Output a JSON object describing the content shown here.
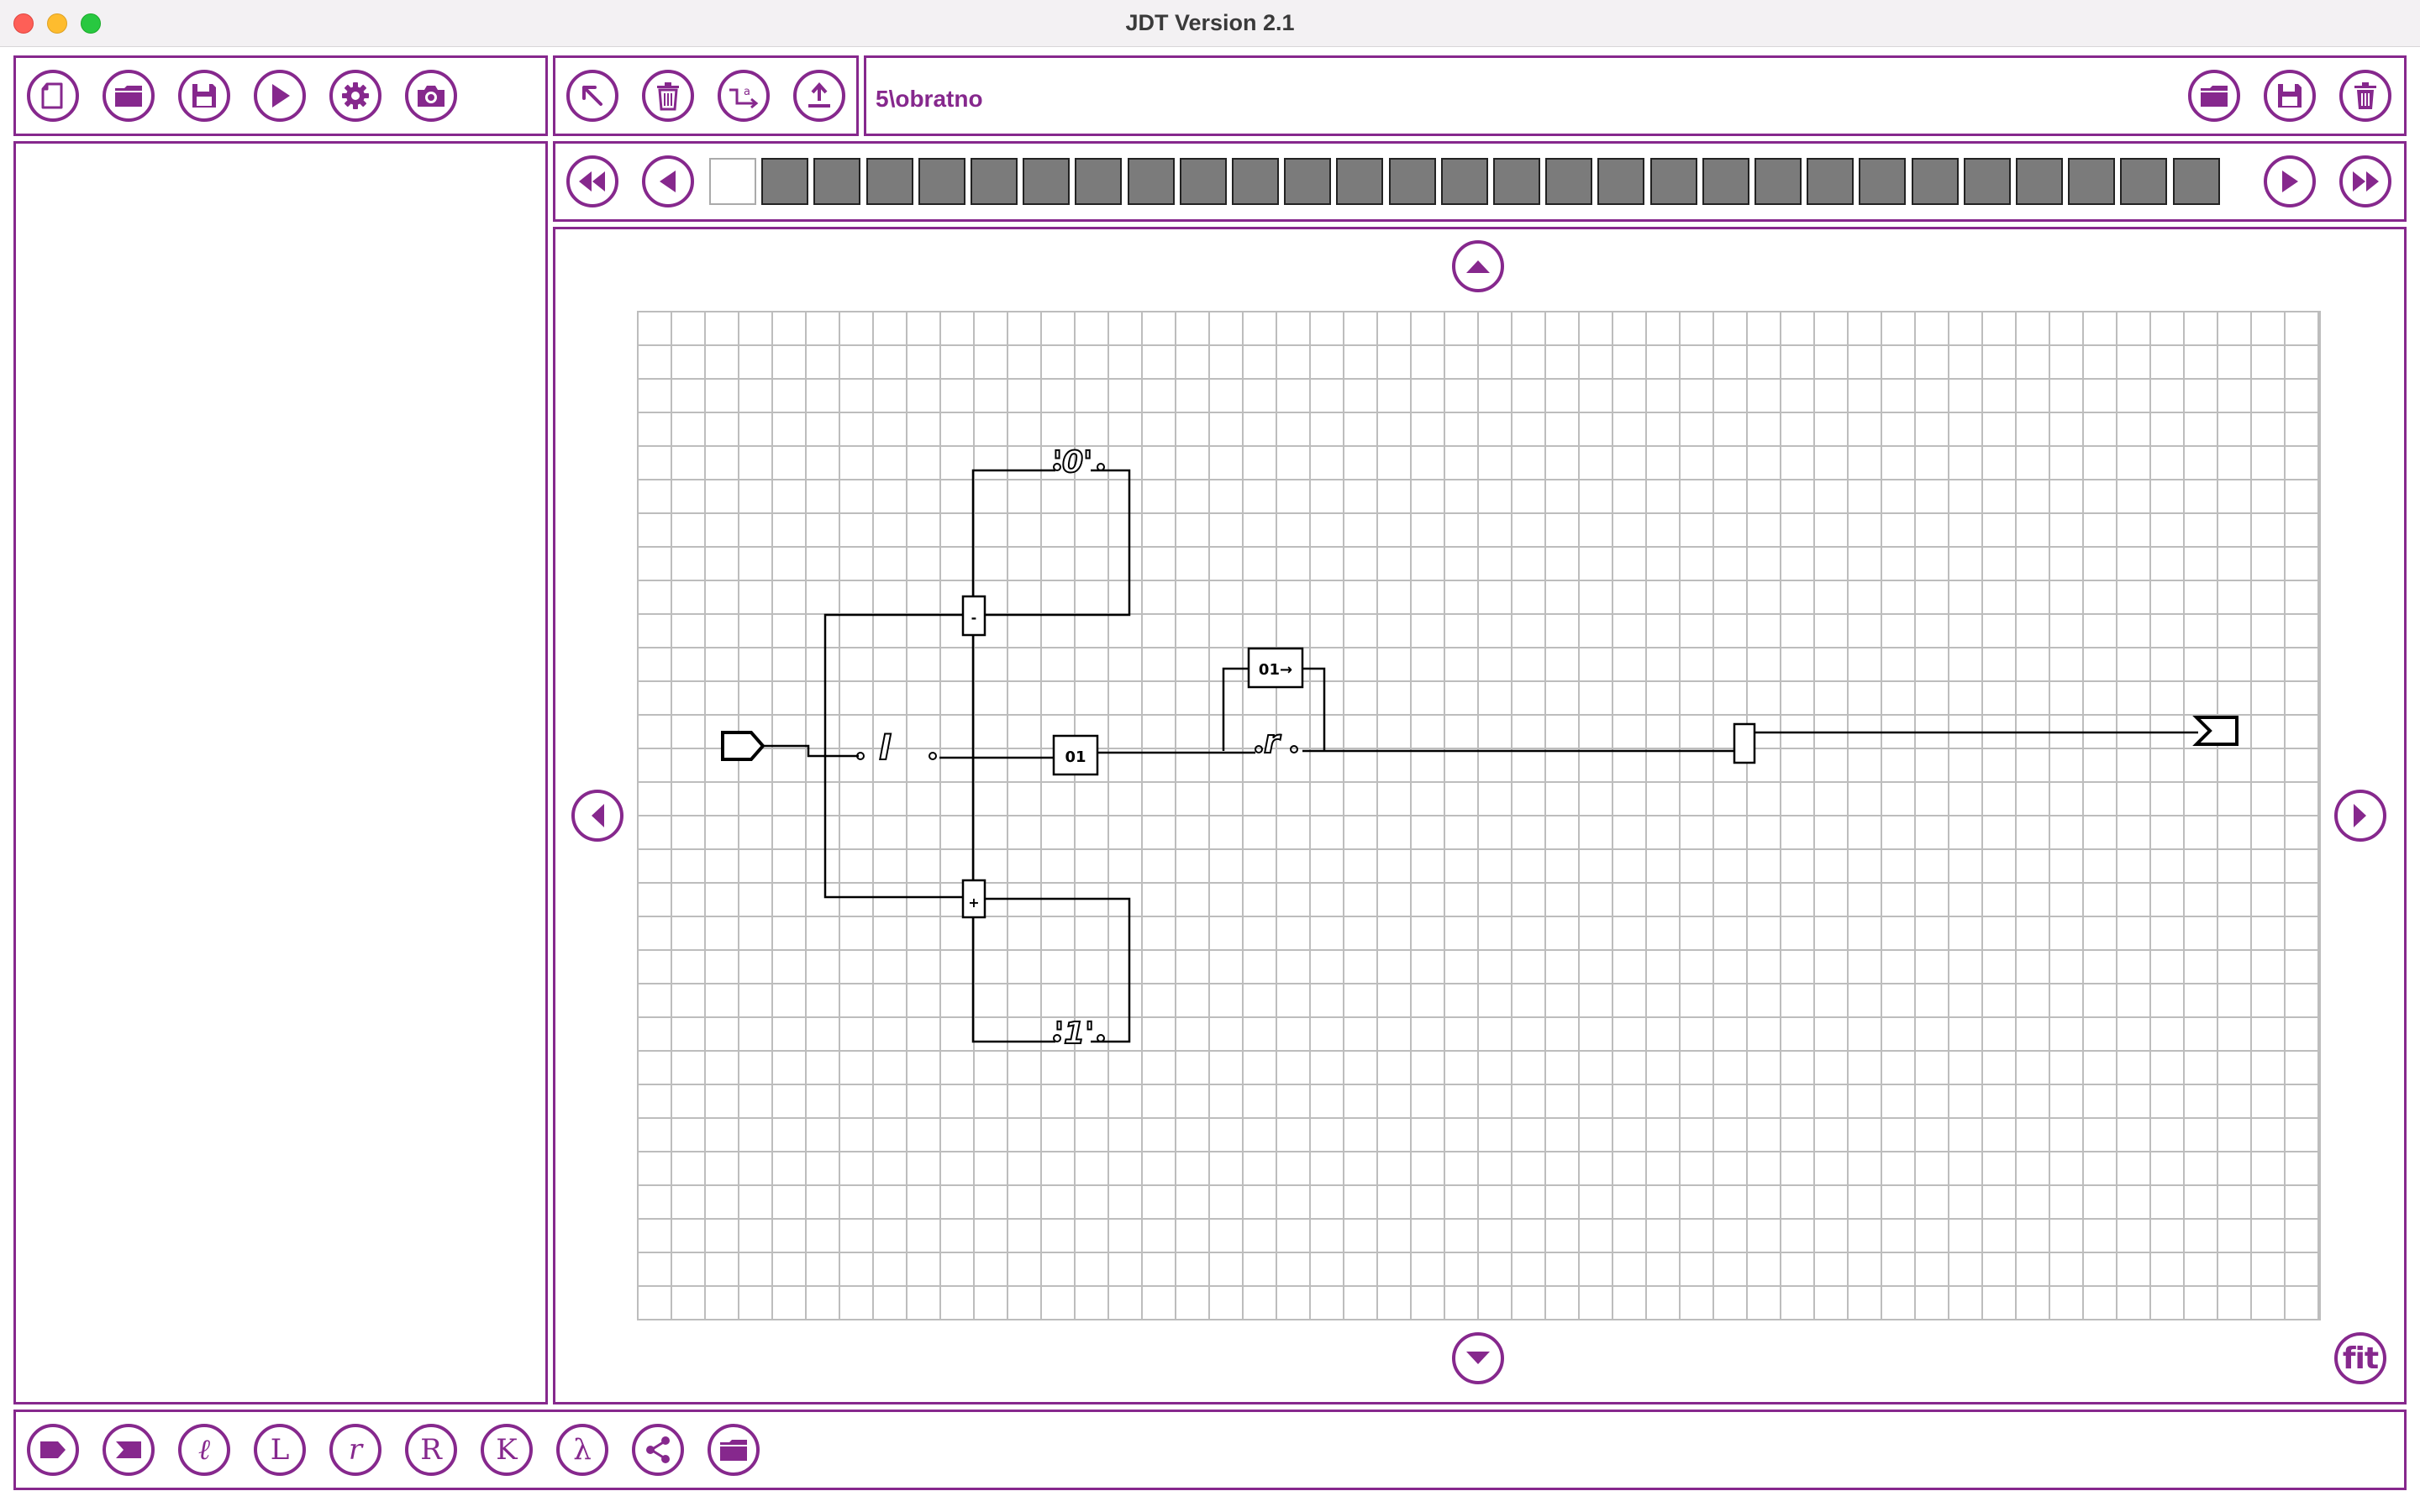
{
  "window": {
    "title": "JDT Version 2.1"
  },
  "toolbar_left": {
    "icons": [
      "new-file-icon",
      "open-folder-icon",
      "save-icon",
      "play-icon",
      "settings-gear-icon",
      "camera-icon"
    ]
  },
  "toolbar_middle": {
    "icons": [
      "pointer-arrow-icon",
      "trash-icon",
      "rename-transition-icon",
      "upload-icon"
    ]
  },
  "file_bar": {
    "path": "5\\obratno",
    "icons": [
      "open-folder-icon",
      "save-icon",
      "trash-icon"
    ]
  },
  "tape": {
    "blank_cells": 1,
    "filled_cells": 28,
    "nav_icons": [
      "rewind-icon",
      "step-back-icon",
      "step-forward-icon",
      "fast-forward-icon"
    ]
  },
  "canvas": {
    "nav_icons": [
      "scroll-up-icon",
      "scroll-down-icon",
      "scroll-left-icon",
      "scroll-right-icon"
    ],
    "fit_label": "fit",
    "nodes": {
      "n_minus": "-",
      "n_plus": "+",
      "n_01": "01",
      "n_01_arrow": "01→",
      "label_0": "'0'",
      "label_1": "'1'",
      "label_l": "l",
      "label_r": "r"
    }
  },
  "bottom_toolbar": {
    "icons": [
      "label-start-icon",
      "label-end-icon",
      "script-l-icon",
      "L-icon",
      "script-r-icon",
      "R-icon",
      "K-icon",
      "lambda-icon",
      "share-icon",
      "open-folder-icon"
    ],
    "letters": {
      "script_l": "ℓ",
      "L": "L",
      "script_r": "r",
      "R": "R",
      "K": "K",
      "lambda": "λ"
    }
  },
  "colors": {
    "accent": "#86288d",
    "tape_filled": "#7b7b7b",
    "grid_line": "#bdbdbd"
  }
}
